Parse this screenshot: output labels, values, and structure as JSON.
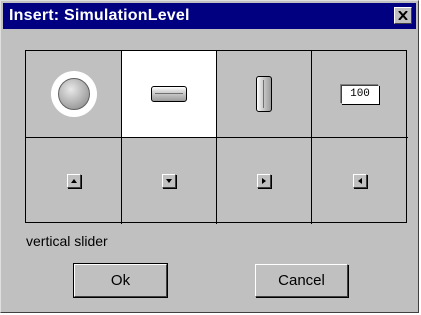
{
  "window": {
    "title": "Insert: SimulationLevel",
    "close_glyph": "✕"
  },
  "widgets": {
    "top_row": [
      {
        "icon": "knob-icon",
        "selected": false
      },
      {
        "icon": "horizontal-slider-icon",
        "selected": true
      },
      {
        "icon": "vertical-slider-icon",
        "selected": false
      },
      {
        "icon": "numeric-display-icon",
        "selected": false,
        "value": "100"
      }
    ],
    "bottom_row": [
      {
        "icon": "arrow-button-icon",
        "arrow": "up"
      },
      {
        "icon": "arrow-button-icon",
        "arrow": "down"
      },
      {
        "icon": "arrow-button-icon",
        "arrow": "right"
      },
      {
        "icon": "arrow-button-icon",
        "arrow": "left"
      }
    ]
  },
  "caption": "vertical slider",
  "buttons": {
    "ok_label": "Ok",
    "cancel_label": "Cancel"
  },
  "colors": {
    "titlebar": "#000080",
    "face": "#c0c0c0",
    "selected_cell": "#ffffff"
  }
}
